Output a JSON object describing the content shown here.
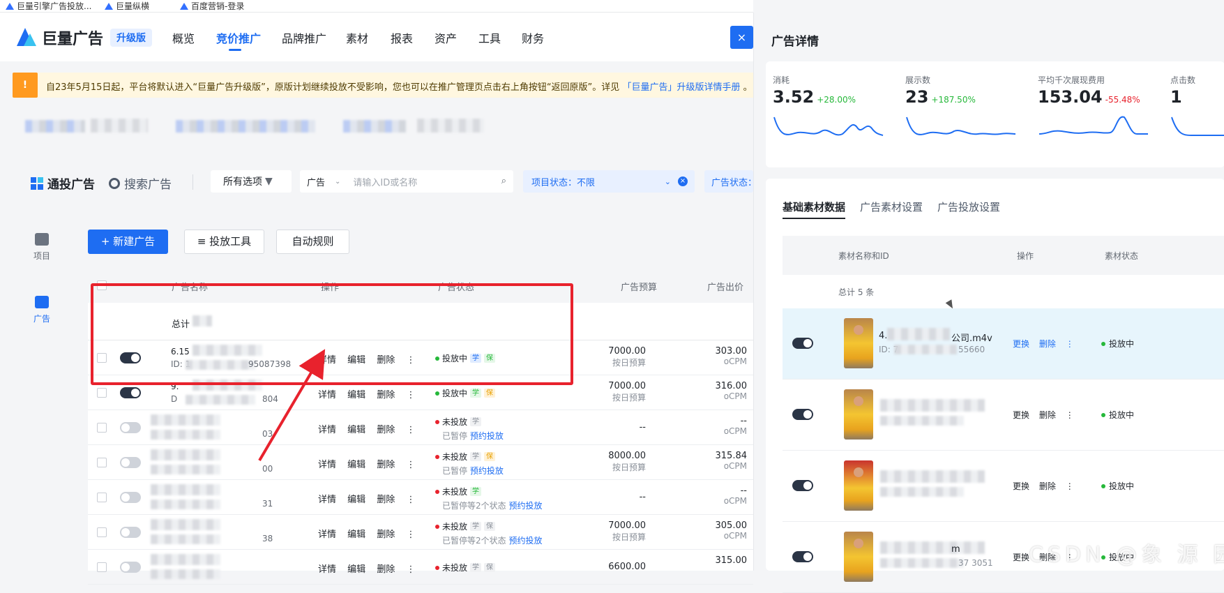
{
  "bookmarks": [
    {
      "label": "巨量引擎广告投放..."
    },
    {
      "label": "巨量纵横"
    },
    {
      "label": "百度营销-登录"
    }
  ],
  "header": {
    "logo_text": "巨量广告",
    "upgrade_badge": "升级版",
    "nav": [
      "概览",
      "竞价推广",
      "品牌推广",
      "素材",
      "报表",
      "资产",
      "工具",
      "财务"
    ],
    "active_nav": "竞价推广",
    "close_symbol": "×"
  },
  "notice": {
    "icon": "!",
    "text": "自23年5月15日起，平台将默认进入“巨量广告升级版”，原版计划继续投放不受影响，您也可以在推广管理页点击右上角按钮“返回原版”。详见",
    "link": "「巨量广告」升级版详情手册",
    "suffix": "。"
  },
  "filters": {
    "tab_uni": "通投广告",
    "tab_search": "搜索广告",
    "all_options": "所有选项",
    "type_select": "广告",
    "search_placeholder": "请输入ID或名称",
    "project_status": "项目状态：不限",
    "ad_status": "广告状态："
  },
  "sidebar": {
    "items": [
      {
        "label": "项目",
        "icon": "project-icon"
      },
      {
        "label": "广告",
        "icon": "ad-icon"
      }
    ]
  },
  "actions": {
    "new_ad": "+ 新建广告",
    "tools": "≡ 投放工具",
    "auto_rules": "自动规则"
  },
  "table": {
    "headers": [
      "广告名称",
      "操作",
      "广告状态",
      "广告预算",
      "广告出价"
    ],
    "total": "总计",
    "ops": [
      "详情",
      "编辑",
      "删除",
      "⋮"
    ],
    "rows": [
      {
        "toggle": true,
        "name1": "6.15",
        "name2": "ID: 1",
        "name2b": "95087398",
        "status": "投放中",
        "status_dot": "g",
        "tags": [
          {
            "t": "学",
            "c": "b"
          },
          {
            "t": "保",
            "c": "gr"
          }
        ],
        "status2": "",
        "status2_link": "",
        "budget": "7000.00",
        "budget_sub": "按日预算",
        "bid": "303.00",
        "bid_sub": "oCPM"
      },
      {
        "toggle": true,
        "name1": "9.",
        "name2": "D",
        "name2b": "804",
        "status": "投放中",
        "status_dot": "g",
        "tags": [
          {
            "t": "学",
            "c": "gr"
          },
          {
            "t": "保",
            "c": "or"
          }
        ],
        "status2": "",
        "status2_link": "",
        "budget": "7000.00",
        "budget_sub": "按日预算",
        "bid": "316.00",
        "bid_sub": "oCPM"
      },
      {
        "toggle": false,
        "name1": "",
        "name2": "",
        "name2b": "03",
        "status": "未投放",
        "status_dot": "r",
        "tags": [
          {
            "t": "学",
            "c": "gy"
          }
        ],
        "status2": "已暂停",
        "status2_link": "预约投放",
        "budget": "--",
        "budget_sub": "",
        "bid": "--",
        "bid_sub": "oCPM"
      },
      {
        "toggle": false,
        "name1": "",
        "name2": "",
        "name2b": "00",
        "status": "未投放",
        "status_dot": "r",
        "tags": [
          {
            "t": "学",
            "c": "gy"
          },
          {
            "t": "保",
            "c": "or"
          }
        ],
        "status2": "已暂停",
        "status2_link": "预约投放",
        "budget": "8000.00",
        "budget_sub": "按日预算",
        "bid": "315.84",
        "bid_sub": "oCPM"
      },
      {
        "toggle": false,
        "name1": "",
        "name2": "",
        "name2b": "31",
        "status": "未投放",
        "status_dot": "r",
        "tags": [
          {
            "t": "学",
            "c": "gr"
          }
        ],
        "status2": "已暂停等2个状态",
        "status2_link": "预约投放",
        "budget": "--",
        "budget_sub": "",
        "bid": "--",
        "bid_sub": "oCPM"
      },
      {
        "toggle": false,
        "name1": "",
        "name2": "",
        "name2b": "38",
        "status": "未投放",
        "status_dot": "r",
        "tags": [
          {
            "t": "学",
            "c": "gy"
          },
          {
            "t": "保",
            "c": "gy"
          }
        ],
        "status2": "已暂停等2个状态",
        "status2_link": "预约投放",
        "budget": "7000.00",
        "budget_sub": "按日预算",
        "bid": "305.00",
        "bid_sub": "oCPM"
      },
      {
        "toggle": false,
        "name1": "",
        "name2": "",
        "name2b": "",
        "status": "未投放",
        "status_dot": "r",
        "tags": [
          {
            "t": "学",
            "c": "gy"
          },
          {
            "t": "保",
            "c": "gy"
          }
        ],
        "status2": "",
        "status2_link": "",
        "budget": "6600.00",
        "budget_sub": "",
        "bid": "315.00",
        "bid_sub": ""
      }
    ]
  },
  "drawer": {
    "title": "广告详情",
    "metrics": [
      {
        "label": "消耗",
        "value": "3.52",
        "change": "+28.00%",
        "dir": "up"
      },
      {
        "label": "展示数",
        "value": "23",
        "change": "+187.50%",
        "dir": "up"
      },
      {
        "label": "平均千次展现费用",
        "value": "153.04",
        "change": "-55.48%",
        "dir": "down"
      },
      {
        "label": "点击数",
        "value": "1",
        "change": "",
        "dir": "up"
      }
    ],
    "tabs": [
      "基础素材数据",
      "广告素材设置",
      "广告投放设置"
    ],
    "headers": [
      "素材名称和ID",
      "操作",
      "素材状态"
    ],
    "total": "总计 5 条",
    "rows": [
      {
        "name": "4.",
        "name_tail": "公司.m4v",
        "id": "ID: 7",
        "id_tail": "55660",
        "ops": [
          "更换",
          "删除",
          "⋮"
        ],
        "status": "投放中",
        "highlight": true
      },
      {
        "name": "",
        "name_tail": "",
        "id": "",
        "id_tail": "",
        "ops": [
          "更换",
          "删除",
          "⋮"
        ],
        "status": "投放中",
        "highlight": false
      },
      {
        "name": "",
        "name_tail": "",
        "id": "",
        "id_tail": "",
        "ops": [
          "更换",
          "删除",
          "⋮"
        ],
        "status": "投放中",
        "highlight": false
      },
      {
        "name": "",
        "name_tail": "m",
        "id": "",
        "id_tail": "37 3051",
        "ops": [
          "更换",
          "删除",
          "⋮"
        ],
        "status": "投放中",
        "highlight": false
      }
    ]
  },
  "watermark": "CSDN @象 源 园",
  "colors": {
    "accent": "#1e6df2",
    "danger": "#e8222d",
    "success": "#26b83a"
  }
}
